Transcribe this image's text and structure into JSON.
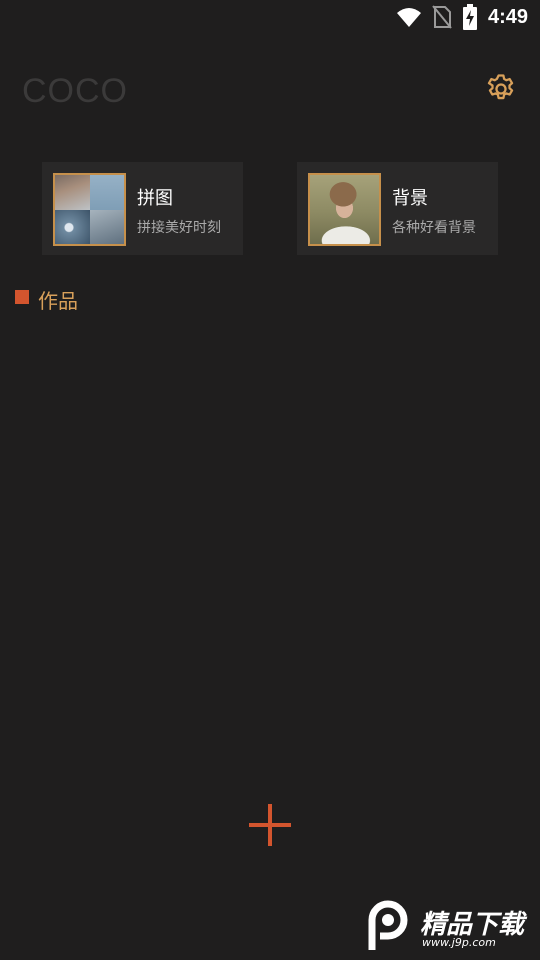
{
  "status_bar": {
    "time": "4:49",
    "icons": [
      "wifi-icon",
      "no-sim-icon",
      "battery-charging-icon"
    ]
  },
  "header": {
    "app_title": "COCO",
    "settings_icon": "gear-icon"
  },
  "features": [
    {
      "title": "拼图",
      "subtitle": "拼接美好时刻"
    },
    {
      "title": "背景",
      "subtitle": "各种好看背景"
    }
  ],
  "works": {
    "label": "作品"
  },
  "add_button": {
    "icon": "plus-icon"
  },
  "watermark": {
    "text": "精品下载",
    "url": "www.j9p.com"
  },
  "colors": {
    "background": "#1f1e1e",
    "card": "#292828",
    "accent_gold": "#c6904b",
    "accent_orange": "#d3552e",
    "works_label": "#d8a05a"
  }
}
